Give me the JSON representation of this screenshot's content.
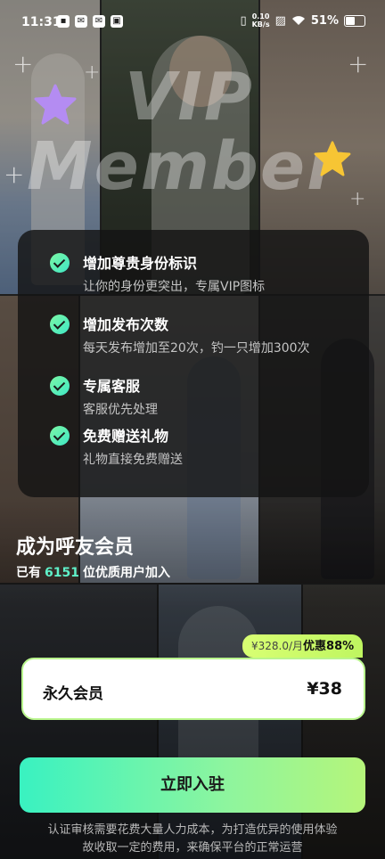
{
  "status_bar": {
    "time": "11:31",
    "net_speed_value": "0.10",
    "net_speed_unit": "KB/s",
    "battery": "51%"
  },
  "hero": {
    "line1": "VIP",
    "line2": "Member"
  },
  "benefits": [
    {
      "title": "增加尊贵身份标识",
      "desc": "让你的身份更突出，专属VIP图标"
    },
    {
      "title": "增加发布次数",
      "desc": "每天发布增加至20次，钓一只增加300次"
    },
    {
      "title": "专属客服",
      "desc": "客服优先处理"
    },
    {
      "title": "免费赠送礼物",
      "desc": "礼物直接免费赠送"
    }
  ],
  "membership": {
    "headline": "成为呼友会员",
    "sub_prefix": "已有",
    "member_count": "6151",
    "sub_suffix": "位优质用户加入"
  },
  "plan": {
    "original_price": "¥328.0/月",
    "discount": "优惠88%",
    "name": "永久会员",
    "price": "¥38"
  },
  "cta": {
    "label": "立即入驻"
  },
  "disclaimer": {
    "line1": "认证审核需要花费大量人力成本，为打造优异的使用体验",
    "line2": "故收取一定的费用，来确保平台的正常运营"
  },
  "colors": {
    "accent": "#5ff0c8",
    "cta_gradient_start": "#39f2c1",
    "cta_gradient_end": "#b5f57a",
    "badge": "#d8ff73"
  },
  "icons": [
    "check-icon",
    "star-icon",
    "plus-icon",
    "wifi-icon",
    "battery-icon"
  ]
}
